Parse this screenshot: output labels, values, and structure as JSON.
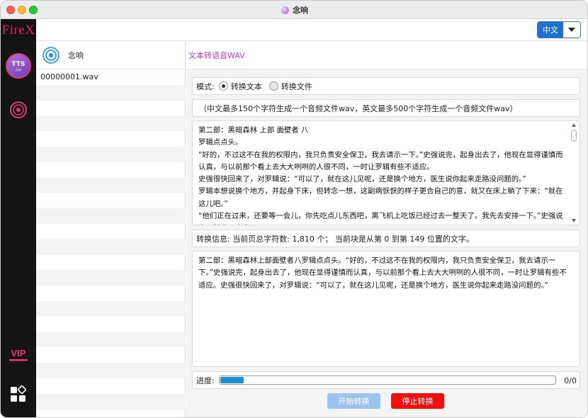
{
  "window": {
    "title": "念响"
  },
  "app": {
    "logo": "FireX"
  },
  "language": {
    "selected": "中文"
  },
  "sidebar": {
    "avatar_title": "TTS",
    "avatar_sub": "念响",
    "items": [
      {
        "icon": "disc-icon"
      },
      {
        "icon": "vip-icon",
        "label": "VIP"
      },
      {
        "icon": "apps-grid-icon"
      }
    ]
  },
  "file_list": {
    "title": "念响",
    "files": [
      "00000001.wav"
    ]
  },
  "main": {
    "title": "文本转语音WAV",
    "mode_label": "模式:",
    "mode_options": [
      "转换文本",
      "转换文件"
    ],
    "mode_selected": "转换文本",
    "hint": "（中文最多150个字符生成一个音频文件wav，英文最多500个字符生成一个音频文件wav）",
    "source_text": [
      "第二部：黑暗森林 上部 面壁者 八",
      "罗辑点点头。",
      "“好的，不过这不在我的权限内，我只负责安全保卫，我去请示一下。”史强说完，起身出去了，他现在显得谨慎而认真，与以前那个看上去大大咧咧的人很不同，一时让罗辑有些不适应。",
      "史强很快回来了，对罗辑说：“可以了，就在这儿见呢，还是换个地方，医生说你起来走路没问题的。”",
      "罗辑本想说换个地方，并起身下床，但转念一想，这副病恹恹的样子更合自己的意，就又在床上躺了下来：“就在这儿吧。”",
      "“他们正在过来，还要等一会儿，你先吃点儿东西吧，离飞机上吃饭已经过去一整天了。我先去安排一下。”史强说完，起身又出去了。"
    ],
    "info": "转换信息:  当前页总字符数: 1,810 个；  当前块是从第 0 到第 149 位置的文字。",
    "chunk_text": "第二部：黑暗森林上部面壁者八罗辑点点头。“好的，不过这不在我的权限内，我只负责安全保卫，我去请示一下。”史强说完，起身出去了，他现在显得谨慎而认真，与以前那个看上去大大咧咧的人很不同，一时让罗辑有些不适应。史强很快回来了，对罗辑说：“可以了，就在这儿见呢，还是换个地方，医生说你起来走路没问题的。”",
    "progress_label": "进度:",
    "progress_fraction": 0.07,
    "progress_count": "0/0",
    "start_button": "开始转换",
    "stop_button": "停止转换"
  },
  "colors": {
    "accent": "#d03ad0",
    "logo": "#e91e63",
    "sidebar_bg": "#141414",
    "progress": "#1d8fd6",
    "start_button": "#9cc3f0",
    "stop_button": "#f01010"
  }
}
